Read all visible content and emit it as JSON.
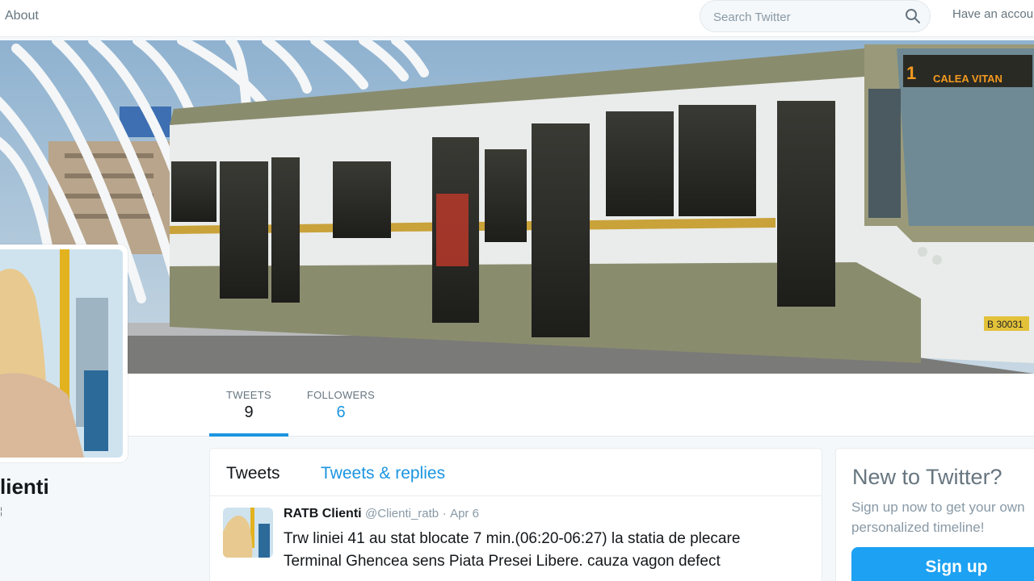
{
  "nav": {
    "about_label": "About",
    "search_placeholder": "Search Twitter",
    "have_account_label": "Have an account?"
  },
  "banner": {
    "tram_route_number": "1",
    "tram_destination": "CALEA VITAN",
    "tram_plate": "B 30031"
  },
  "profile": {
    "name_visible": "lienti",
    "name_mark": "¦"
  },
  "stats": {
    "tweets": {
      "label": "TWEETS",
      "value": "9"
    },
    "followers": {
      "label": "FOLLOWERS",
      "value": "6"
    }
  },
  "timeline": {
    "tabs": [
      {
        "label": "Tweets"
      },
      {
        "label": "Tweets & replies"
      }
    ],
    "tweets": [
      {
        "name": "RATB Clienti",
        "handle": "@Clienti_ratb",
        "separator": "·",
        "date": "Apr 6",
        "text": "Trw liniei 41 au stat blocate 7 min.(06:20-06:27) la statia de plecare Terminal Ghencea sens Piata Presei Libere. cauza vagon defect"
      }
    ]
  },
  "signup": {
    "title": "New to Twitter?",
    "subtitle": "Sign up now to get your own personalized timeline!",
    "button_label": "Sign up"
  },
  "colors": {
    "accent": "#1b95e0",
    "signup_button": "#1da1f2",
    "tram_body": "#8a8c6e"
  }
}
